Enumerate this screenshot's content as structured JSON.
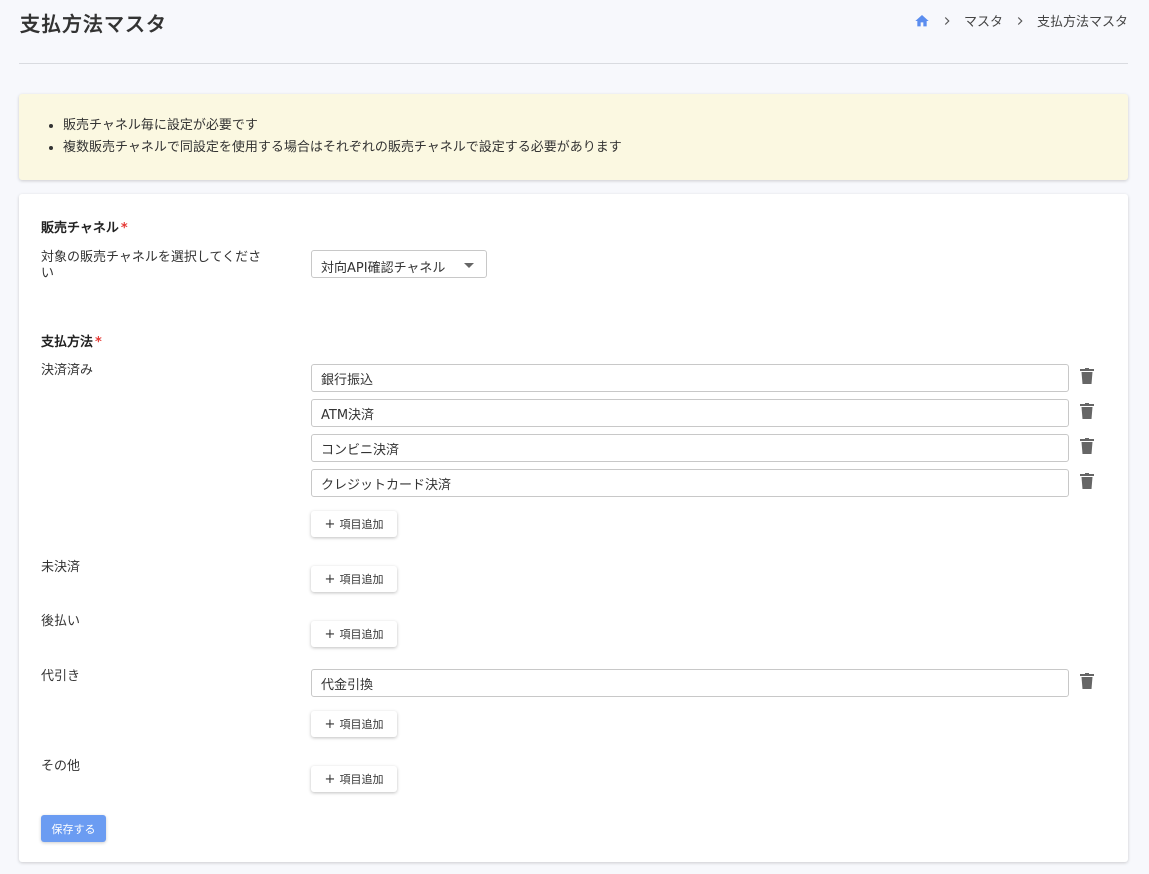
{
  "header": {
    "title": "支払方法マスタ",
    "breadcrumb": [
      "マスタ",
      "支払方法マスタ"
    ]
  },
  "notice": {
    "items": [
      "販売チャネル毎に設定が必要です",
      "複数販売チャネルで同設定を使用する場合はそれぞれの販売チャネルで設定する必要があります"
    ]
  },
  "channel": {
    "title": "販売チャネル",
    "required_mark": "*",
    "label_line1": "対象の販売チャネルを選択してくださ",
    "label_line2": "い",
    "selected": "対向API確認チャネル"
  },
  "payment": {
    "title": "支払方法",
    "required_mark": "*",
    "add_label": "項目追加",
    "groups": [
      {
        "label": "決済済み",
        "items": [
          "銀行振込",
          "ATM決済",
          "コンビニ決済",
          "クレジットカード決済"
        ]
      },
      {
        "label": "未決済",
        "items": []
      },
      {
        "label": "後払い",
        "items": []
      },
      {
        "label": "代引き",
        "items": [
          "代金引換"
        ]
      },
      {
        "label": "その他",
        "items": []
      }
    ]
  },
  "save_label": "保存する",
  "colors": {
    "accent": "#6b9cf2",
    "notice_bg": "#fbf8e1",
    "required": "#e53935"
  }
}
